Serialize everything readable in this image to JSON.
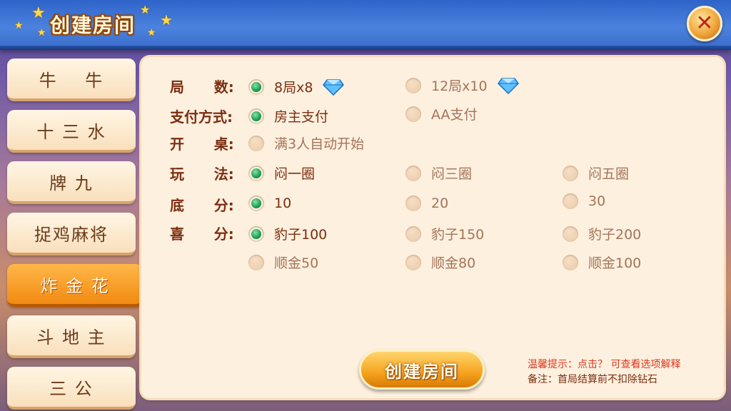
{
  "header": {
    "title": "创建房间",
    "close_symbol": "✕",
    "icons": [
      "star-icon",
      "close-icon",
      "diamond-icon",
      "radio-icon"
    ]
  },
  "sidebar": {
    "items": [
      {
        "label": "牛    牛",
        "active": false
      },
      {
        "label": "十 三 水",
        "active": false
      },
      {
        "label": "牌 九",
        "active": false
      },
      {
        "label": "捉鸡麻将",
        "active": false
      },
      {
        "label": "炸 金 花",
        "active": true
      },
      {
        "label": "斗 地 主",
        "active": false
      },
      {
        "label": "三 公",
        "active": false
      }
    ]
  },
  "settings": {
    "rounds": {
      "label": "局      数:",
      "options": [
        "8局x8",
        "12局x10"
      ],
      "selected": 0
    },
    "payment": {
      "label": "支付方式:",
      "options": [
        "房主支付",
        "AA支付"
      ],
      "selected": 0
    },
    "start": {
      "label": "开      桌:",
      "options": [
        "满3人自动开始"
      ],
      "selected": -1
    },
    "play": {
      "label": "玩      法:",
      "options": [
        "闷一圈",
        "闷三圈",
        "闷五圈"
      ],
      "selected": 0
    },
    "base": {
      "label": "底      分:",
      "options": [
        "10",
        "20",
        "30"
      ],
      "selected": 0
    },
    "bonus": {
      "label": "喜      分:",
      "options": [
        "豹子100",
        "豹子150",
        "豹子200",
        "顺金50",
        "顺金80",
        "顺金100"
      ],
      "selected": 0
    }
  },
  "actions": {
    "create_label": "创建房间"
  },
  "tips": {
    "line1": "温馨提示：点击？ 可查看选项解释",
    "line2": "备注：首局结算前不扣除钻石"
  },
  "colors": {
    "accent": "#f28a12",
    "selected_radio": "#1f9a52",
    "label": "#7c2d10",
    "tip": "#e0371d"
  }
}
